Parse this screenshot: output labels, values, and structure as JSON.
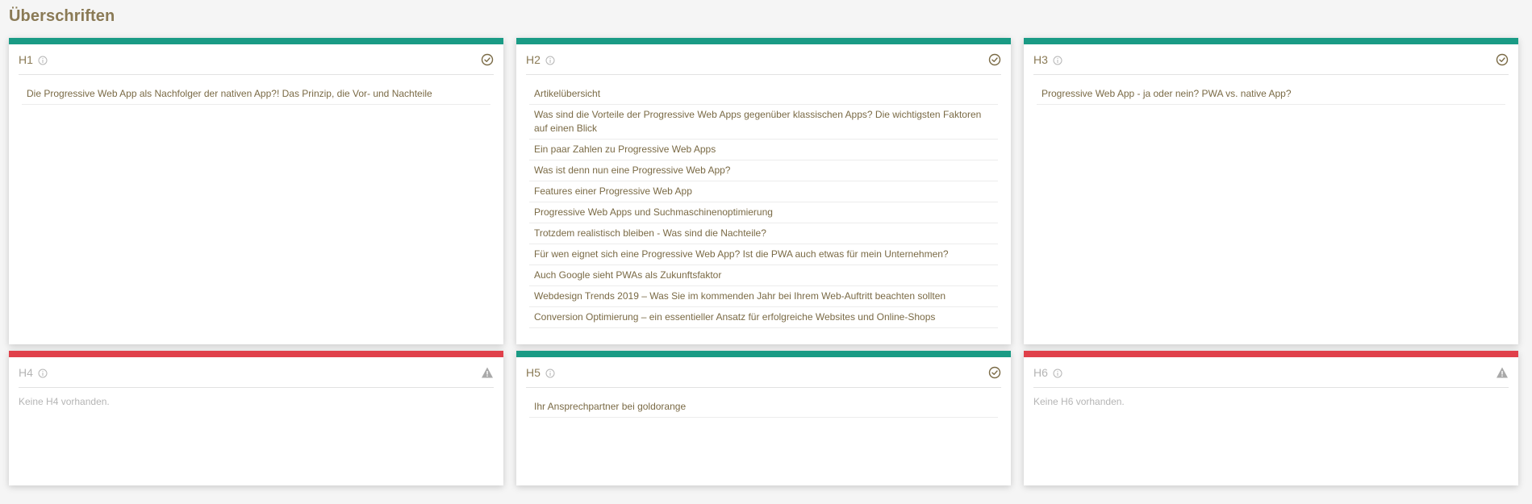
{
  "page": {
    "title": "Überschriften"
  },
  "colors": {
    "ok": "#1a9b85",
    "missing": "#e0404a"
  },
  "cards": [
    {
      "id": "h1",
      "title": "H1",
      "status": "ok",
      "status_icon": "check-circle-icon",
      "items": [
        "Die Progressive Web App als Nachfolger der nativen App?! Das Prinzip, die Vor- und Nachteile"
      ]
    },
    {
      "id": "h2",
      "title": "H2",
      "status": "ok",
      "status_icon": "check-circle-icon",
      "items": [
        "Artikelübersicht",
        "Was sind die Vorteile der Progressive Web Apps gegenüber klassischen Apps? Die wichtigsten Faktoren auf einen Blick",
        "Ein paar Zahlen zu Progressive Web Apps",
        "Was ist denn nun eine Progressive Web App?",
        "Features einer Progressive Web App",
        "Progressive Web Apps und Suchmaschinenoptimierung",
        "Trotzdem realistisch bleiben - Was sind die Nachteile?",
        "Für wen eignet sich eine Progressive Web App? Ist die PWA auch etwas für mein Unternehmen?",
        "Auch Google sieht PWAs als Zukunftsfaktor",
        "Webdesign Trends 2019 – Was Sie im kommenden Jahr bei Ihrem Web-Auftritt beachten sollten",
        "Conversion Optimierung – ein essentieller Ansatz für erfolgreiche Websites und Online-Shops"
      ]
    },
    {
      "id": "h3",
      "title": "H3",
      "status": "ok",
      "status_icon": "check-circle-icon",
      "items": [
        "Progressive Web App - ja oder nein? PWA vs. native App?"
      ]
    },
    {
      "id": "h4",
      "title": "H4",
      "status": "missing",
      "status_icon": "warning-triangle-icon",
      "empty_text": "Keine H4 vorhanden."
    },
    {
      "id": "h5",
      "title": "H5",
      "status": "ok",
      "status_icon": "check-circle-icon",
      "items": [
        "Ihr Ansprechpartner bei goldorange"
      ]
    },
    {
      "id": "h6",
      "title": "H6",
      "status": "missing",
      "status_icon": "warning-triangle-icon",
      "empty_text": "Keine H6 vorhanden."
    }
  ]
}
